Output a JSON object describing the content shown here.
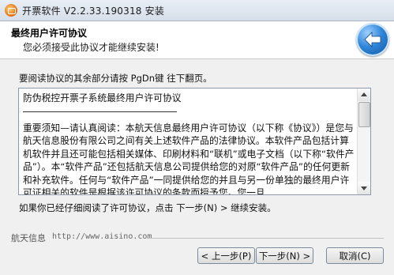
{
  "window": {
    "title": "开票软件 V2.2.33.190318 安装"
  },
  "header": {
    "title": "最终用户许可协议",
    "subtitle": "您必须接受此协议才能继续安装!"
  },
  "instruction": "要阅读协议的其余部分请按 PgDn键 往下翻页。",
  "license": {
    "heading": "防伪税控开票子系统最终用户许可协议",
    "paragraph": "重要须知—请认真阅读：本航天信息最终用户许可协议（以下称《协议》）是您与航天信息股份有限公司之间有关上述软件产品的法律协议。本软件产品包括计算机软件并且还可能包括相关媒体、印刷材料和“联机”或电子文档（以下称“软件产品”）。本“软件产品”还包括航天信息公司提供给您的对原“软件产品”的任何更新和补充软件。任何与“软件产品”一同提供给您的并且与另一份单独的最终用户许可证相关的软件是根据该许可协议的条款而授予您。您一旦"
  },
  "note": "如果你已经仔细阅读了许可协议，点击 下一步(N) > 继续安装。",
  "footer": {
    "brand": "航天信息",
    "url": "http://www.aisino.com"
  },
  "buttons": {
    "back": "< 上一步(P)",
    "next": "下一步(N) >",
    "cancel": "取消(C)"
  },
  "icons": {
    "app": "app-icon",
    "back": "back-arrow-icon"
  }
}
